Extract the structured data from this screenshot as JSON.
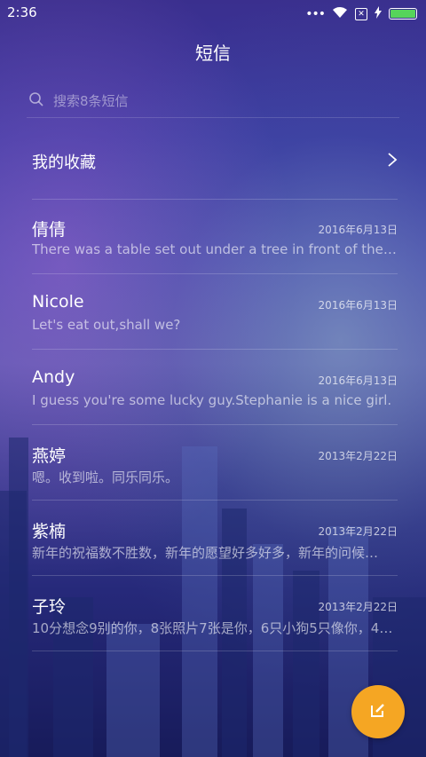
{
  "status": {
    "time": "2:36",
    "more": "•••"
  },
  "header": {
    "title": "短信"
  },
  "search": {
    "placeholder": "搜索8条短信"
  },
  "favorites": {
    "label": "我的收藏"
  },
  "conversations": [
    {
      "name": "倩倩",
      "date": "2016年6月13日",
      "preview": "There was a table set out under a tree in front of the ho…"
    },
    {
      "name": "Nicole",
      "date": "2016年6月13日",
      "preview": "Let's eat out,shall we?"
    },
    {
      "name": "Andy",
      "date": "2016年6月13日",
      "preview": "I guess you're some lucky guy.Stephanie is a nice girl."
    },
    {
      "name": "燕婷",
      "date": "2013年2月22日",
      "preview": "嗯。收到啦。同乐同乐。"
    },
    {
      "name": "紫楠",
      "date": "2013年2月22日",
      "preview": "新年的祝福数不胜数，新年的愿望好多好多，新年的问候…"
    },
    {
      "name": "子玲",
      "date": "2013年2月22日",
      "preview": "10分想念9别的你，8张照片7张是你，6只小狗5只像你，4…"
    }
  ],
  "fab": {
    "icon": "compose-icon",
    "color": "#f5a623"
  },
  "colors": {
    "battery": "#56d45a",
    "background_top": "#3a2f8e",
    "background_bottom": "#171b5a"
  }
}
